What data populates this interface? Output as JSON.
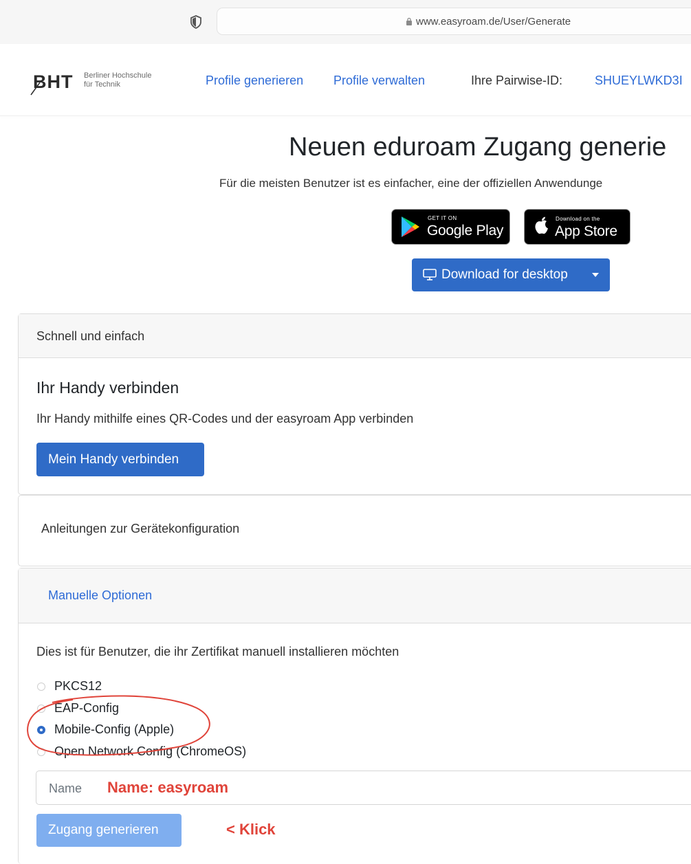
{
  "browser": {
    "url": "www.easyroam.de/User/Generate"
  },
  "logo": {
    "mark": "BHT",
    "line1": "Berliner Hochschule",
    "line2": "für Technik"
  },
  "nav": {
    "generate_label": "Profile generieren",
    "manage_label": "Profile verwalten",
    "pairwise_label": "Ihre Pairwise-ID:",
    "pairwise_value": "SHUEYLWKD3I"
  },
  "hero": {
    "title": "Neuen eduroam Zugang generie",
    "subtitle": "Für die meisten Benutzer ist es einfacher, eine der offiziellen Anwendunge"
  },
  "badges": {
    "google_small": "GET IT ON",
    "google_big": "Google Play",
    "apple_small": "Download on the",
    "apple_big": "App Store"
  },
  "download_button": {
    "label": "Download for desktop"
  },
  "quick_card": {
    "header": "Schnell und einfach",
    "title": "Ihr Handy verbinden",
    "description": "Ihr Handy mithilfe eines QR-Codes und der easyroam App verbinden",
    "button_label": "Mein Handy verbinden"
  },
  "guide_card": {
    "label": "Anleitungen zur Gerätekonfiguration"
  },
  "manual_card": {
    "header": "Manuelle Optionen",
    "description": "Dies ist für Benutzer, die ihr Zertifikat manuell installieren möchten",
    "options": [
      {
        "label": "PKCS12",
        "checked": false
      },
      {
        "label": "EAP-Config",
        "checked": false
      },
      {
        "label": "Mobile-Config (Apple)",
        "checked": true
      },
      {
        "label": "Open Network Config (ChromeOS)",
        "checked": false
      }
    ],
    "name_placeholder": "Name",
    "submit_label": "Zugang generieren"
  },
  "annotations": {
    "name_hint": "Name: easyroam",
    "click_hint": "< Klick",
    "color": "#e0443a"
  }
}
